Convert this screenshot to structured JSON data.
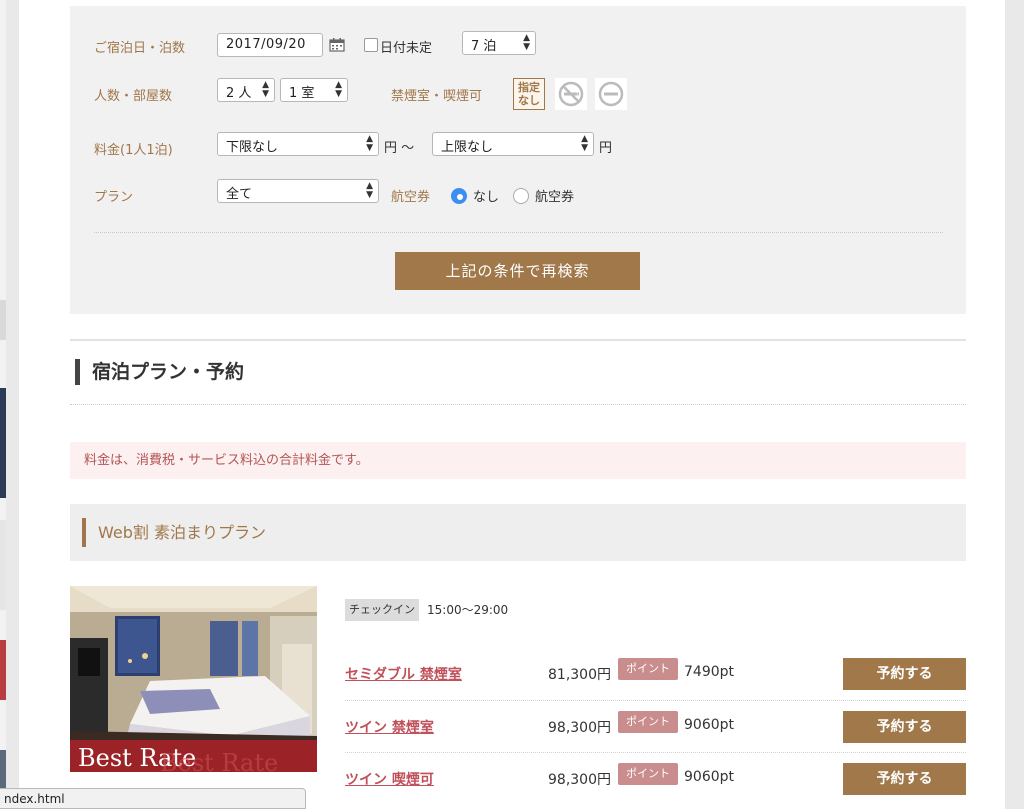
{
  "search": {
    "stay_label": "ご宿泊日・泊数",
    "date_value": "2017/09/20",
    "date_undecided_label": "日付未定",
    "nights_value": "7 泊",
    "guests_label": "人数・部屋数",
    "people_value": "2 人",
    "rooms_value": "1 室",
    "smoking_label": "禁煙室・喫煙可",
    "smoking_any_label": "指定なし",
    "price_label": "料金(1人1泊)",
    "price_min_value": "下限なし",
    "price_sep": "円 〜",
    "price_max_value": "上限なし",
    "price_unit": "円",
    "plan_label": "プラン",
    "plan_value": "全て",
    "flight_label": "航空券",
    "flight_none_label": "なし",
    "flight_yes_label": "航空券",
    "research_button": "上記の条件で再検索"
  },
  "section": {
    "title": "宿泊プラン・予約",
    "notice": "料金は、消費税・サービス料込の合計料金です。"
  },
  "plan": {
    "title": "Web割 素泊まりプラン",
    "image_caption": "Best Rate",
    "checkin_label": "チェックイン",
    "checkin_time": "15:00〜29:00",
    "rooms": [
      {
        "name": "セミダブル 禁煙室",
        "price": "81,300円",
        "point_label": "ポイント",
        "points": "7490pt",
        "button": "予約する"
      },
      {
        "name": "ツイン 禁煙室",
        "price": "98,300円",
        "point_label": "ポイント",
        "points": "9060pt",
        "button": "予約する"
      },
      {
        "name": "ツイン 喫煙可",
        "price": "98,300円",
        "point_label": "ポイント",
        "points": "9060pt",
        "button": "予約する"
      }
    ]
  },
  "status_bar": {
    "url": "ndex.html"
  },
  "colors": {
    "accent_brown": "#a0784a",
    "room_link": "#c0505a",
    "point_badge": "#c98d8d",
    "notice_bg": "#fdf0f0",
    "radio_on": "#3b8ff0"
  }
}
